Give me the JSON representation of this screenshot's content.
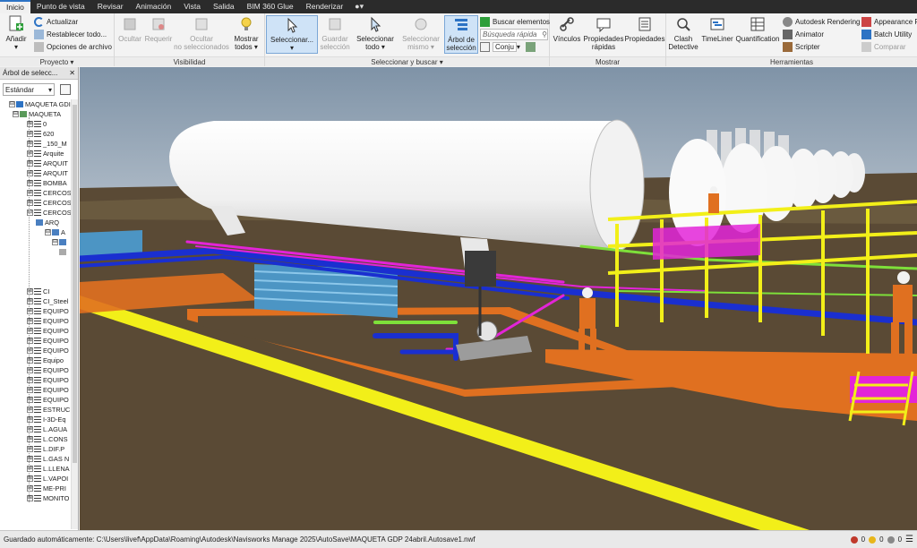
{
  "tabs": [
    {
      "label": "Inicio",
      "active": true
    },
    {
      "label": "Punto de vista"
    },
    {
      "label": "Revisar"
    },
    {
      "label": "Animación"
    },
    {
      "label": "Vista"
    },
    {
      "label": "Salida"
    },
    {
      "label": "BIM 360 Glue"
    },
    {
      "label": "Renderizar"
    }
  ],
  "ribbon": {
    "proyecto": {
      "title": "Proyecto",
      "add": "Añadir",
      "refresh": "Actualizar",
      "reset": "Restablecer todo...",
      "options": "Opciones de archivo"
    },
    "visibilidad": {
      "title": "Visibilidad",
      "hide": "Ocultar",
      "require": "Requerir",
      "hide_unselected_1": "Ocultar",
      "hide_unselected_2": "no seleccionados",
      "show_all_1": "Mostrar",
      "show_all_2": "todos"
    },
    "seleccionar": {
      "title": "Seleccionar y buscar",
      "select": "Seleccionar...",
      "save_1": "Guardar",
      "save_2": "selección",
      "select_all_1": "Seleccionar",
      "select_all_2": "todo",
      "select_same_1": "Seleccionar",
      "select_same_2": "mismo",
      "tree_1": "Árbol de",
      "tree_2": "selección",
      "find": "Buscar elementos",
      "quick_find_placeholder": "Búsqueda rápida",
      "sets": "Conju"
    },
    "mostrar": {
      "title": "Mostrar",
      "links": "Vínculos",
      "quick_props_1": "Propiedades",
      "quick_props_2": "rápidas",
      "props": "Propiedades"
    },
    "herramientas": {
      "title": "Herramientas",
      "clash_1": "Clash",
      "clash_2": "Detective",
      "timeliner": "TimeLiner",
      "quantification": "Quantification",
      "rendering": "Autodesk Rendering",
      "animator": "Animator",
      "scripter": "Scripter",
      "appearance": "Appearance P",
      "batch": "Batch Utility",
      "compare": "Comparar"
    }
  },
  "sidebar": {
    "title": "Árbol de selecc...",
    "dropdown": "Estándar",
    "items": [
      "MAQUETA GDI",
      "MAQUETA",
      "0",
      "620",
      "_150_M",
      "Arquite",
      "ARQUIT",
      "ARQUIT",
      "BOMBA",
      "CERCOS",
      "CERCOS",
      "CERCOS",
      "ARQ",
      "A",
      "",
      "CI",
      "CI_Steel",
      "EQUIPO",
      "EQUIPO",
      "EQUIPO",
      "EQUIPO",
      "EQUIPO",
      "Equipo",
      "EQUIPO",
      "EQUIPO",
      "EQUIPO",
      "EQUIPO",
      "ESTRUC",
      "I-3D-Eq",
      "L.AGUA",
      "L.CONS",
      "L.DIF.P",
      "L.GAS N",
      "L.LLENA",
      "L.VAPOI",
      "ME-PRI",
      "MONITO"
    ]
  },
  "status": {
    "autosave": "Guardado automáticamente: C:\\Users\\livef\\AppData\\Roaming\\Autodesk\\Navisworks Manage 2025\\AutoSave\\MAQUETA GDP 24abril.Autosave1.nwf",
    "count_a": "0",
    "count_b": "0",
    "count_c": "0"
  },
  "colors": {
    "accent": "#2d73c4",
    "sky": "#8da1b3",
    "ground": "#5b4a34",
    "yellow": "#f2ef19",
    "magenta": "#e324d8",
    "blue": "#1a2fd0",
    "orange": "#e07020",
    "green": "#7ee03a"
  }
}
